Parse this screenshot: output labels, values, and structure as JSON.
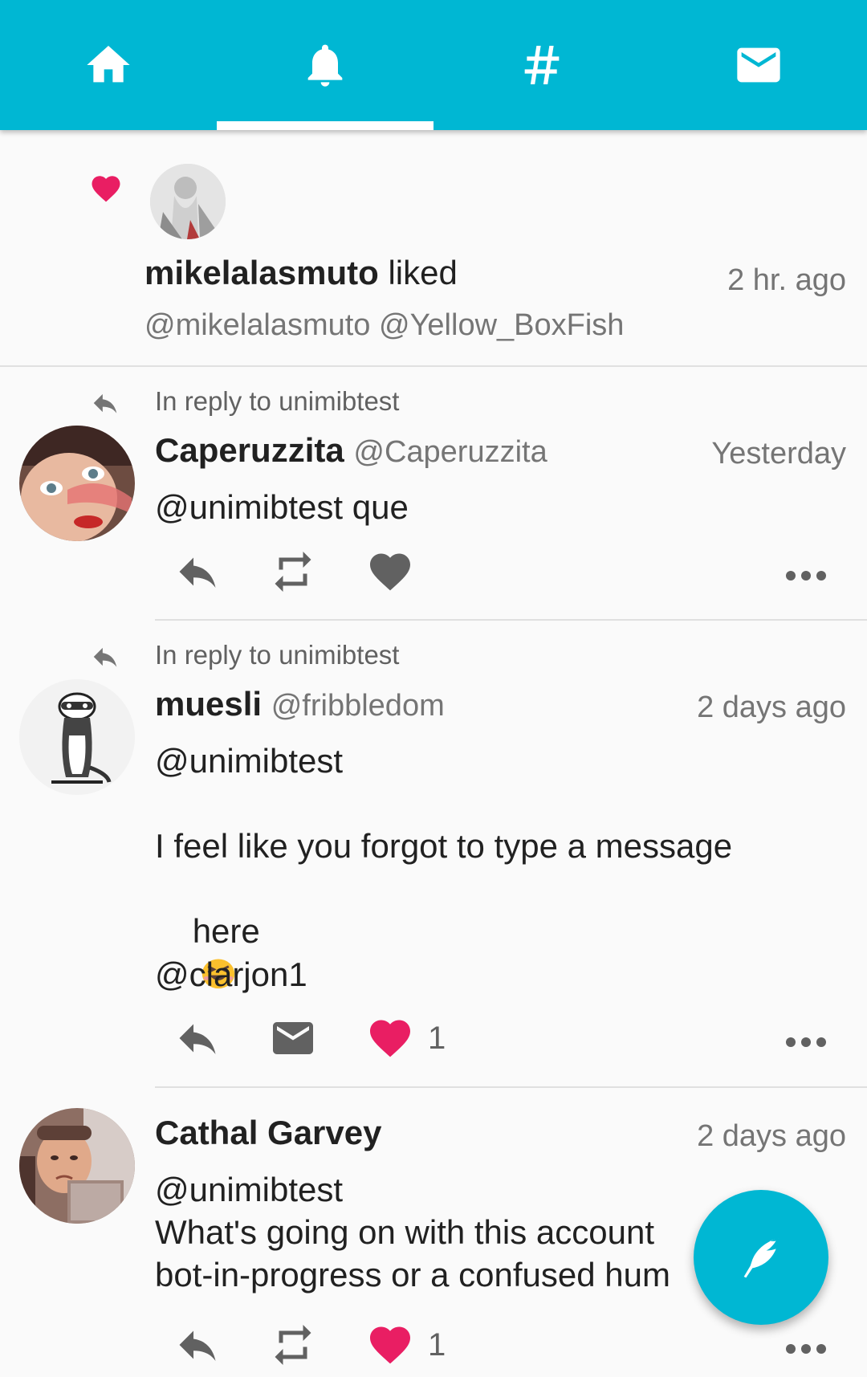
{
  "nav": {
    "tabs": [
      {
        "name": "home",
        "icon": "home-icon"
      },
      {
        "name": "notifications",
        "icon": "bell-icon",
        "active": true
      },
      {
        "name": "hashtags",
        "icon": "hashtag-icon"
      },
      {
        "name": "messages",
        "icon": "mail-icon"
      }
    ],
    "accent_color": "#00b7d3"
  },
  "notification": {
    "icon": "heart-icon",
    "user": "mikelalasmuto",
    "action": " liked",
    "time": "2 hr. ago",
    "content": "@mikelalasmuto @Yellow_BoxFish"
  },
  "posts": [
    {
      "reply_to": "In reply to unimibtest",
      "display_name": "Caperuzzita",
      "handle": "@Caperuzzita",
      "time": "Yesterday",
      "text": "@unimibtest que",
      "actions": {
        "second": "retweet-icon",
        "likes": "",
        "liked": false
      }
    },
    {
      "reply_to": "In reply to unimibtest",
      "display_name": "muesli",
      "handle": "@fribbledom",
      "time": "2 days ago",
      "text_line1": "@unimibtest",
      "text_line2": "I feel like you forgot to type a message",
      "text_line3": "here",
      "text_line4": "@clarjon1",
      "emoji": "squinting-laugh-emoji",
      "actions": {
        "second": "mail-icon",
        "likes": "1",
        "liked": true
      }
    },
    {
      "display_name": "Cathal Garvey",
      "time": "2 days ago",
      "text_line1": "@unimibtest",
      "text_line2": "What's going on with this account",
      "text_line3": "bot-in-progress or a confused hum",
      "actions": {
        "second": "retweet-icon",
        "likes": "1",
        "liked": true
      }
    }
  ],
  "fab": {
    "icon": "quill-compose-icon"
  }
}
